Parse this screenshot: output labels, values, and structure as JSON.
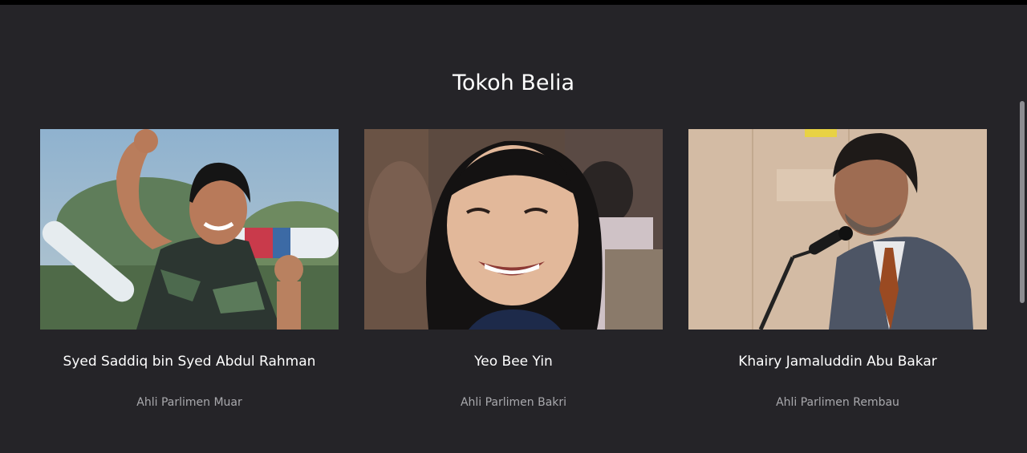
{
  "section": {
    "title": "Tokoh Belia"
  },
  "people": [
    {
      "name": "Syed Saddiq bin Syed Abdul Rahman",
      "role": "Ahli Parlimen Muar"
    },
    {
      "name": "Yeo Bee Yin",
      "role": "Ahli Parlimen Bakri"
    },
    {
      "name": "Khairy Jamaluddin Abu Bakar",
      "role": "Ahli Parlimen Rembau"
    }
  ],
  "colors": {
    "background": "#252428",
    "title": "#ffffff",
    "name": "#ffffff",
    "role": "#a9a9ad"
  }
}
